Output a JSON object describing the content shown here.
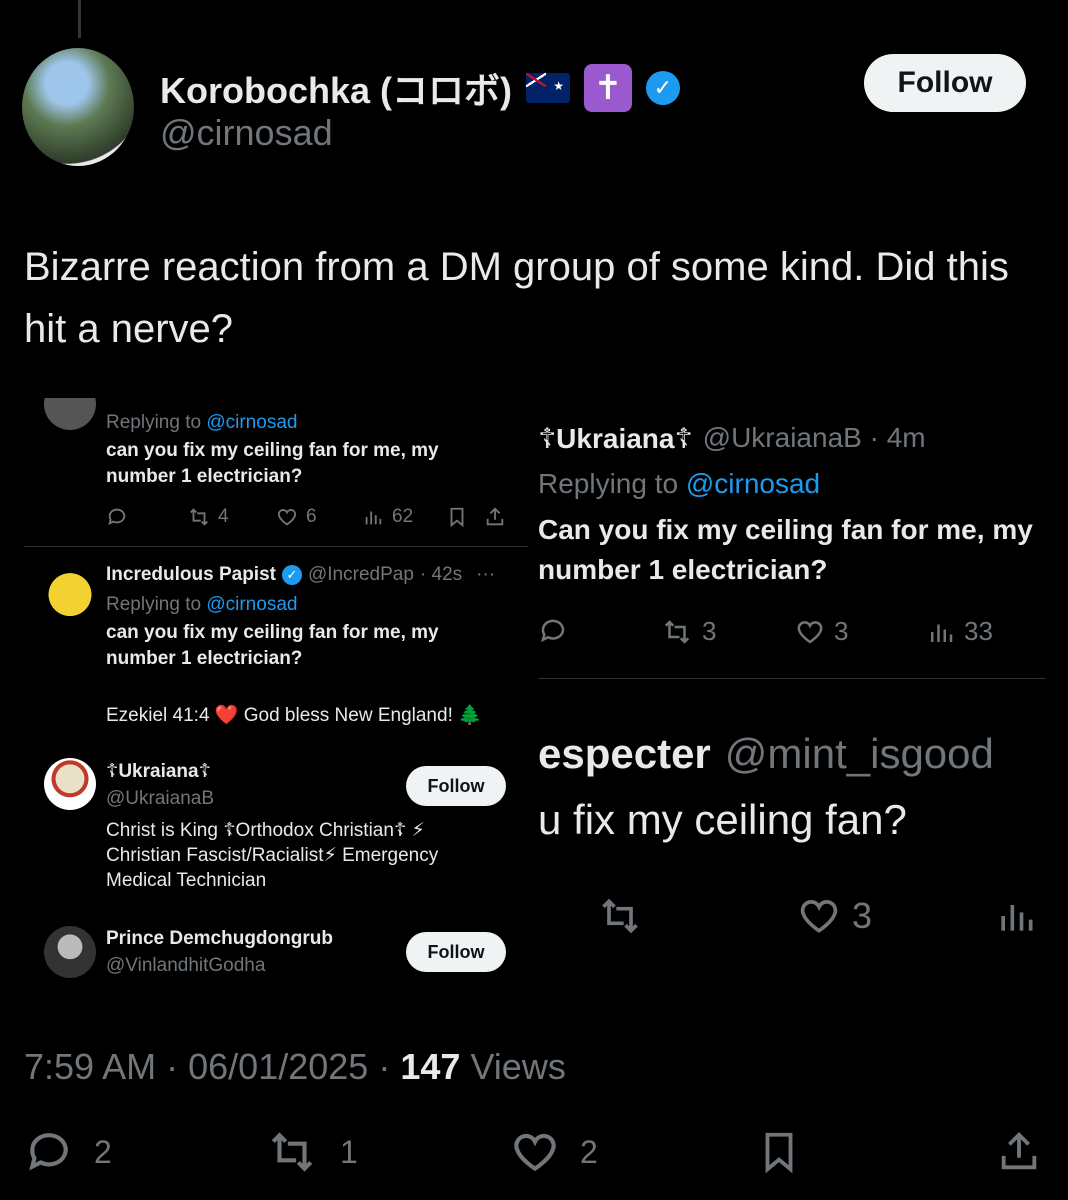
{
  "tweet": {
    "display_name": "Korobochka (コロボ)",
    "handle": "@cirnosad",
    "follow_label": "Follow",
    "cross_badge": "✝",
    "text": "Bizarre reaction from a DM group of some kind. Did this hit a nerve?",
    "time": "7:59 AM",
    "date": "06/01/2025",
    "views_count": "147",
    "views_label": "Views",
    "separator": "·",
    "replies": "2",
    "retweets": "1",
    "likes": "2"
  },
  "left_shot": {
    "first_reply": {
      "replying_prefix": "Replying to",
      "replying_handle": "@cirnosad",
      "body": "can you fix my ceiling fan for me, my number 1 electrician?",
      "retweets": "4",
      "likes": "6",
      "views": "62"
    },
    "second_reply": {
      "name": "Incredulous Papist",
      "handle": "@IncredPap",
      "time": "· 42s",
      "more": "···",
      "replying_prefix": "Replying to",
      "replying_handle": "@cirnosad",
      "body": "can you fix my ceiling fan for me, my number 1 electrician?"
    },
    "bio_line": "Ezekiel 41:4 ❤️ God bless New England! 🌲",
    "profiles": [
      {
        "name": "☦Ukraiana☦",
        "handle": "@UkraianaB",
        "follow_label": "Follow",
        "bio": "Christ is King ☦Orthodox Christian☦ ⚡ Christian Fascist/Racialist⚡ Emergency Medical Technician"
      },
      {
        "name": "Prince Demchugdongrub",
        "handle": "@VinlandhitGodha",
        "follow_label": "Follow"
      }
    ]
  },
  "right_shot": {
    "first": {
      "name": "☦Ukraiana☦",
      "handle_time": "@UkraianaB · 4m",
      "replying_prefix": "Replying to",
      "replying_handle": "@cirnosad",
      "body": "Can you fix my ceiling fan for me, my number 1 electrician?",
      "retweets": "3",
      "likes": "3",
      "views": "33"
    },
    "second": {
      "name": "especter",
      "handle": "@mint_isgood",
      "body": "u fix my ceiling fan?",
      "likes": "3"
    }
  },
  "colors": {
    "background": "#000000",
    "text": "#e7e9ea",
    "muted": "#71767b",
    "link": "#1d9bf0",
    "verified": "#1d9bf0",
    "orthodox_badge": "#9b59d0"
  }
}
